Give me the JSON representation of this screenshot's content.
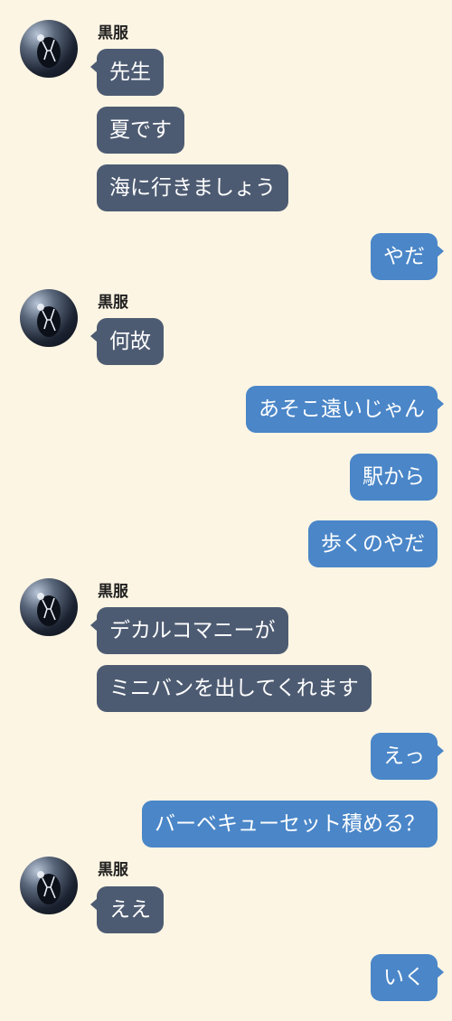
{
  "contact": {
    "name": "黒服"
  },
  "messages": [
    {
      "side": "in",
      "text": "先生"
    },
    {
      "side": "in",
      "text": "夏です"
    },
    {
      "side": "in",
      "text": "海に行きましょう"
    },
    {
      "side": "out",
      "text": "やだ"
    },
    {
      "side": "in",
      "text": "何故"
    },
    {
      "side": "out",
      "text": "あそこ遠いじゃん"
    },
    {
      "side": "out",
      "text": "駅から"
    },
    {
      "side": "out",
      "text": "歩くのやだ"
    },
    {
      "side": "in",
      "text": "デカルコマニーが"
    },
    {
      "side": "in",
      "text": "ミニバンを出してくれます"
    },
    {
      "side": "out",
      "text": "えっ"
    },
    {
      "side": "out",
      "text": "バーベキューセット積める？"
    },
    {
      "side": "in",
      "text": "ええ"
    },
    {
      "side": "out",
      "text": "いく"
    }
  ],
  "colors": {
    "background": "#fdf5e3",
    "incoming_bubble": "#4d5b72",
    "outgoing_bubble": "#4a86c8"
  }
}
